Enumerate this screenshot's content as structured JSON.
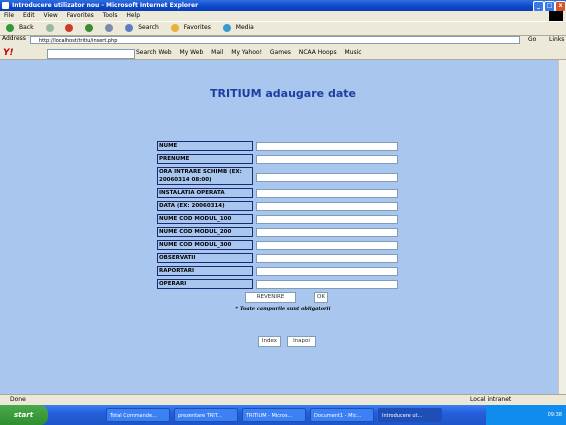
{
  "window": {
    "title": "Introducere utilizator nou - Microsoft Internet Explorer",
    "minimize": "_",
    "maximize": "□",
    "close": "x"
  },
  "menu": [
    "File",
    "Edit",
    "View",
    "Favorites",
    "Tools",
    "Help"
  ],
  "toolbar": {
    "back": "Back",
    "search": "Search",
    "favorites": "Favorites",
    "media": "Media"
  },
  "address": {
    "label": "Address",
    "url": "http://localhost/tritiu/insert.php",
    "go": "Go",
    "links": "Links"
  },
  "yahoo": {
    "logo": "Y!",
    "search_web": "Search Web",
    "my_web": "My Web",
    "mail": "Mail",
    "my_yahoo": "My Yahoo!",
    "games": "Games",
    "ncaa": "NCAA Hoops",
    "music": "Music"
  },
  "page": {
    "title": "TRITIUM adaugare date",
    "fields": [
      {
        "label": "NUME"
      },
      {
        "label": "PRENUME"
      },
      {
        "label": "ORA INTRARE SCHIMB (EX: 20060314 08:00)"
      },
      {
        "label": "INSTALATIA OPERATA"
      },
      {
        "label": "DATA (EX: 20060314)"
      },
      {
        "label": "NUME COD MODUL_100"
      },
      {
        "label": "NUME COD MODUL_200"
      },
      {
        "label": "NUME COD MODUL_300"
      },
      {
        "label": "OBSERVATII"
      },
      {
        "label": "RAPORTARI"
      },
      {
        "label": "OPERARI"
      }
    ],
    "revenire": "REVENIRE",
    "ok": "OK",
    "note": "* Toate campurile sunt obligatorii",
    "index": "Index",
    "inapoi": "Inapoi"
  },
  "status": {
    "text": "Done",
    "zone": "Local intranet"
  },
  "taskbar": {
    "start": "start",
    "tasks": [
      "Total Commande...",
      "prezentare TRIT...",
      "TRITIUM - Micros...",
      "Document1 - Mic...",
      "Introducere ut..."
    ],
    "clock": "09:38"
  }
}
